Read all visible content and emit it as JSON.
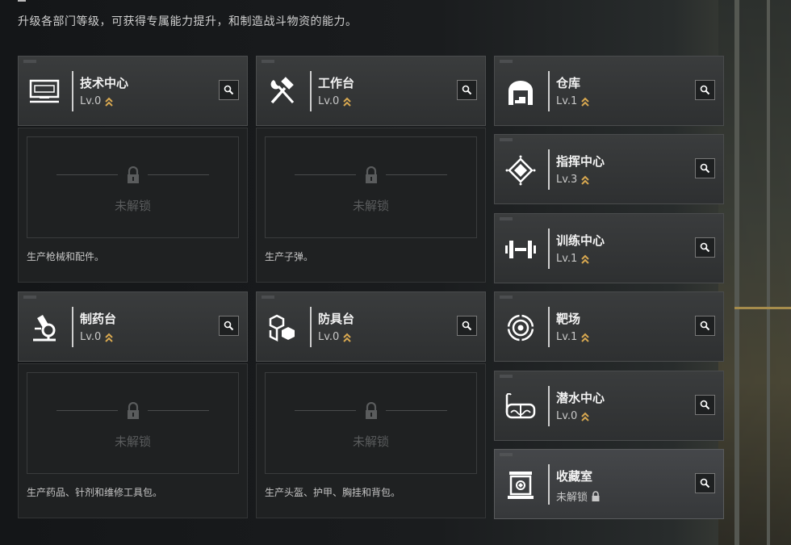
{
  "subtitle": "升级各部门等级，可获得专属能力提升，和制造战斗物资的能力。",
  "locked_label": "未解锁",
  "left_modules": [
    {
      "name": "技术中心",
      "level": "Lv.0",
      "icon": "monitor-icon",
      "desc": "生产枪械和配件。"
    },
    {
      "name": "工作台",
      "level": "Lv.0",
      "icon": "hammer-wrench-icon",
      "desc": "生产子弹。"
    },
    {
      "name": "制药台",
      "level": "Lv.0",
      "icon": "microscope-icon",
      "desc": "生产药品、针剂和维修工具包。"
    },
    {
      "name": "防具台",
      "level": "Lv.0",
      "icon": "armor-icon",
      "desc": "生产头盔、护甲、胸挂和背包。"
    }
  ],
  "right_modules": [
    {
      "name": "仓库",
      "level": "Lv.1",
      "icon": "warehouse-icon"
    },
    {
      "name": "指挥中心",
      "level": "Lv.3",
      "icon": "command-icon"
    },
    {
      "name": "训练中心",
      "level": "Lv.1",
      "icon": "dumbbell-icon"
    },
    {
      "name": "靶场",
      "level": "Lv.1",
      "icon": "target-icon"
    },
    {
      "name": "潜水中心",
      "level": "Lv.0",
      "icon": "dive-mask-icon"
    },
    {
      "name": "收藏室",
      "level": "未解锁",
      "icon": "collection-icon",
      "locked": true
    }
  ],
  "colors": {
    "upgrade_chevron": "#d8a850",
    "accent": "#f2f2f2"
  }
}
